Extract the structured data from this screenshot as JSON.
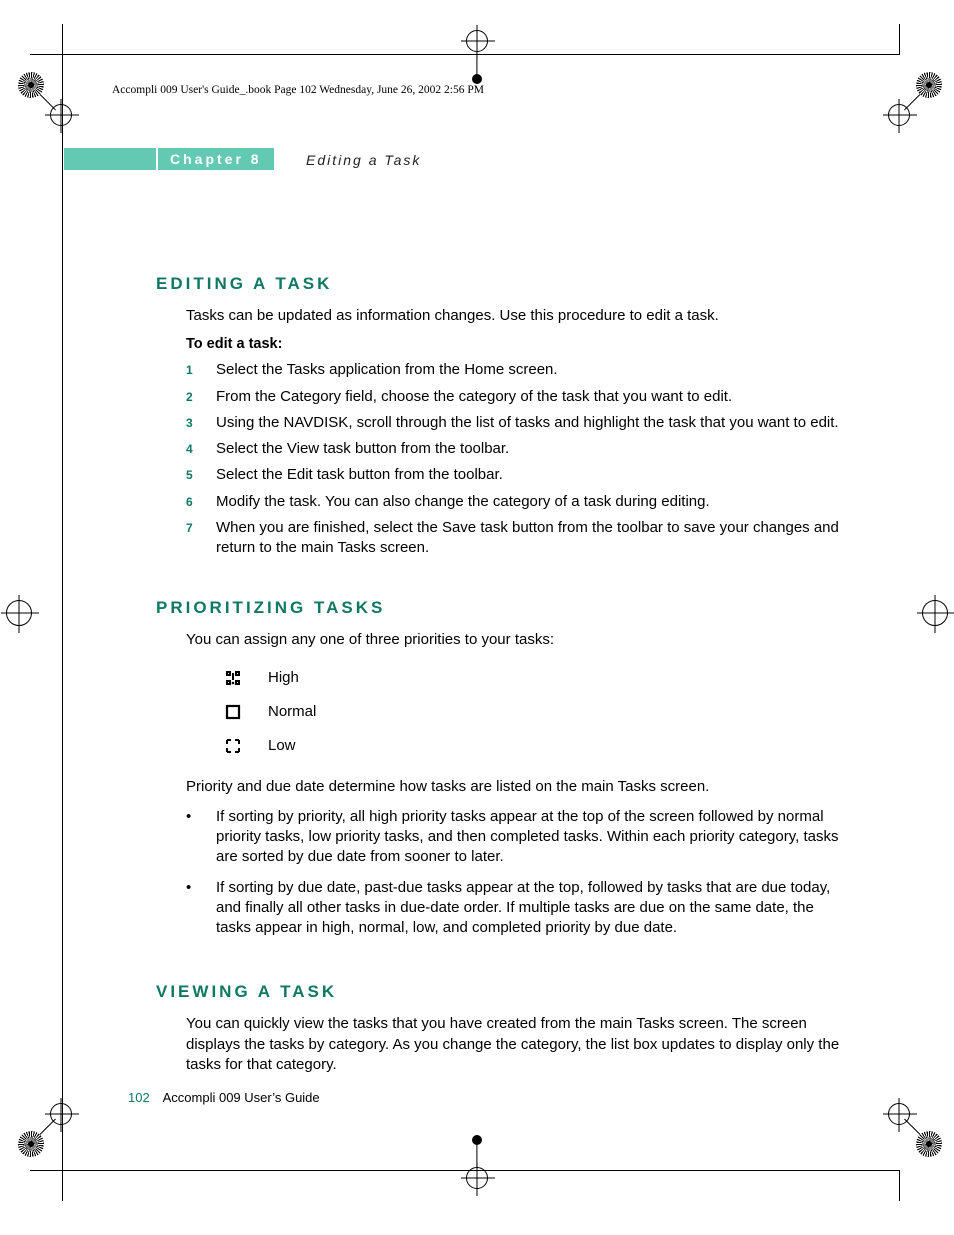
{
  "meta_header": "Accompli 009 User's Guide_.book  Page 102  Wednesday, June 26, 2002  2:56 PM",
  "chapter_label": "Chapter 8",
  "chapter_title": "Editing a Task",
  "sections": {
    "editing": {
      "heading": "EDITING A TASK",
      "intro": "Tasks can be updated as information changes. Use this procedure to edit a task.",
      "lead": "To edit a task:",
      "steps": [
        "Select the Tasks application from the Home screen.",
        "From the Category field, choose the category of the task that you want to edit.",
        "Using the NAVDISK, scroll through the list of tasks and highlight the task that you want to edit.",
        "Select the View task button from the toolbar.",
        "Select the Edit task button from the toolbar.",
        "Modify the task. You can also change the category of a task during editing.",
        "When you are finished, select the Save task button from the toolbar to save your changes and return to the main Tasks screen."
      ]
    },
    "prioritizing": {
      "heading": "PRIORITIZING TASKS",
      "intro": "You can assign any one of three priorities to your tasks:",
      "levels": [
        {
          "label": "High"
        },
        {
          "label": "Normal"
        },
        {
          "label": "Low"
        }
      ],
      "after": "Priority and due date determine how tasks are listed on the main Tasks screen.",
      "bullets": [
        "If sorting by priority, all high priority tasks appear at the top of the screen followed by normal priority tasks, low priority tasks, and then completed tasks. Within each priority category, tasks are sorted by due date from sooner to later.",
        "If sorting by due date, past-due tasks appear at the top, followed by tasks that are due today, and finally all other tasks in due-date order. If multiple tasks are due on the same date, the tasks appear in high, normal, low, and completed priority by due date."
      ]
    },
    "viewing": {
      "heading": "VIEWING A TASK",
      "intro": "You can quickly view the tasks that you have created from the main Tasks screen. The screen displays the tasks by category. As you change the category, the list box updates to display only the tasks for that category."
    }
  },
  "footer": {
    "page": "102",
    "book": "Accompli 009 User’s Guide"
  }
}
